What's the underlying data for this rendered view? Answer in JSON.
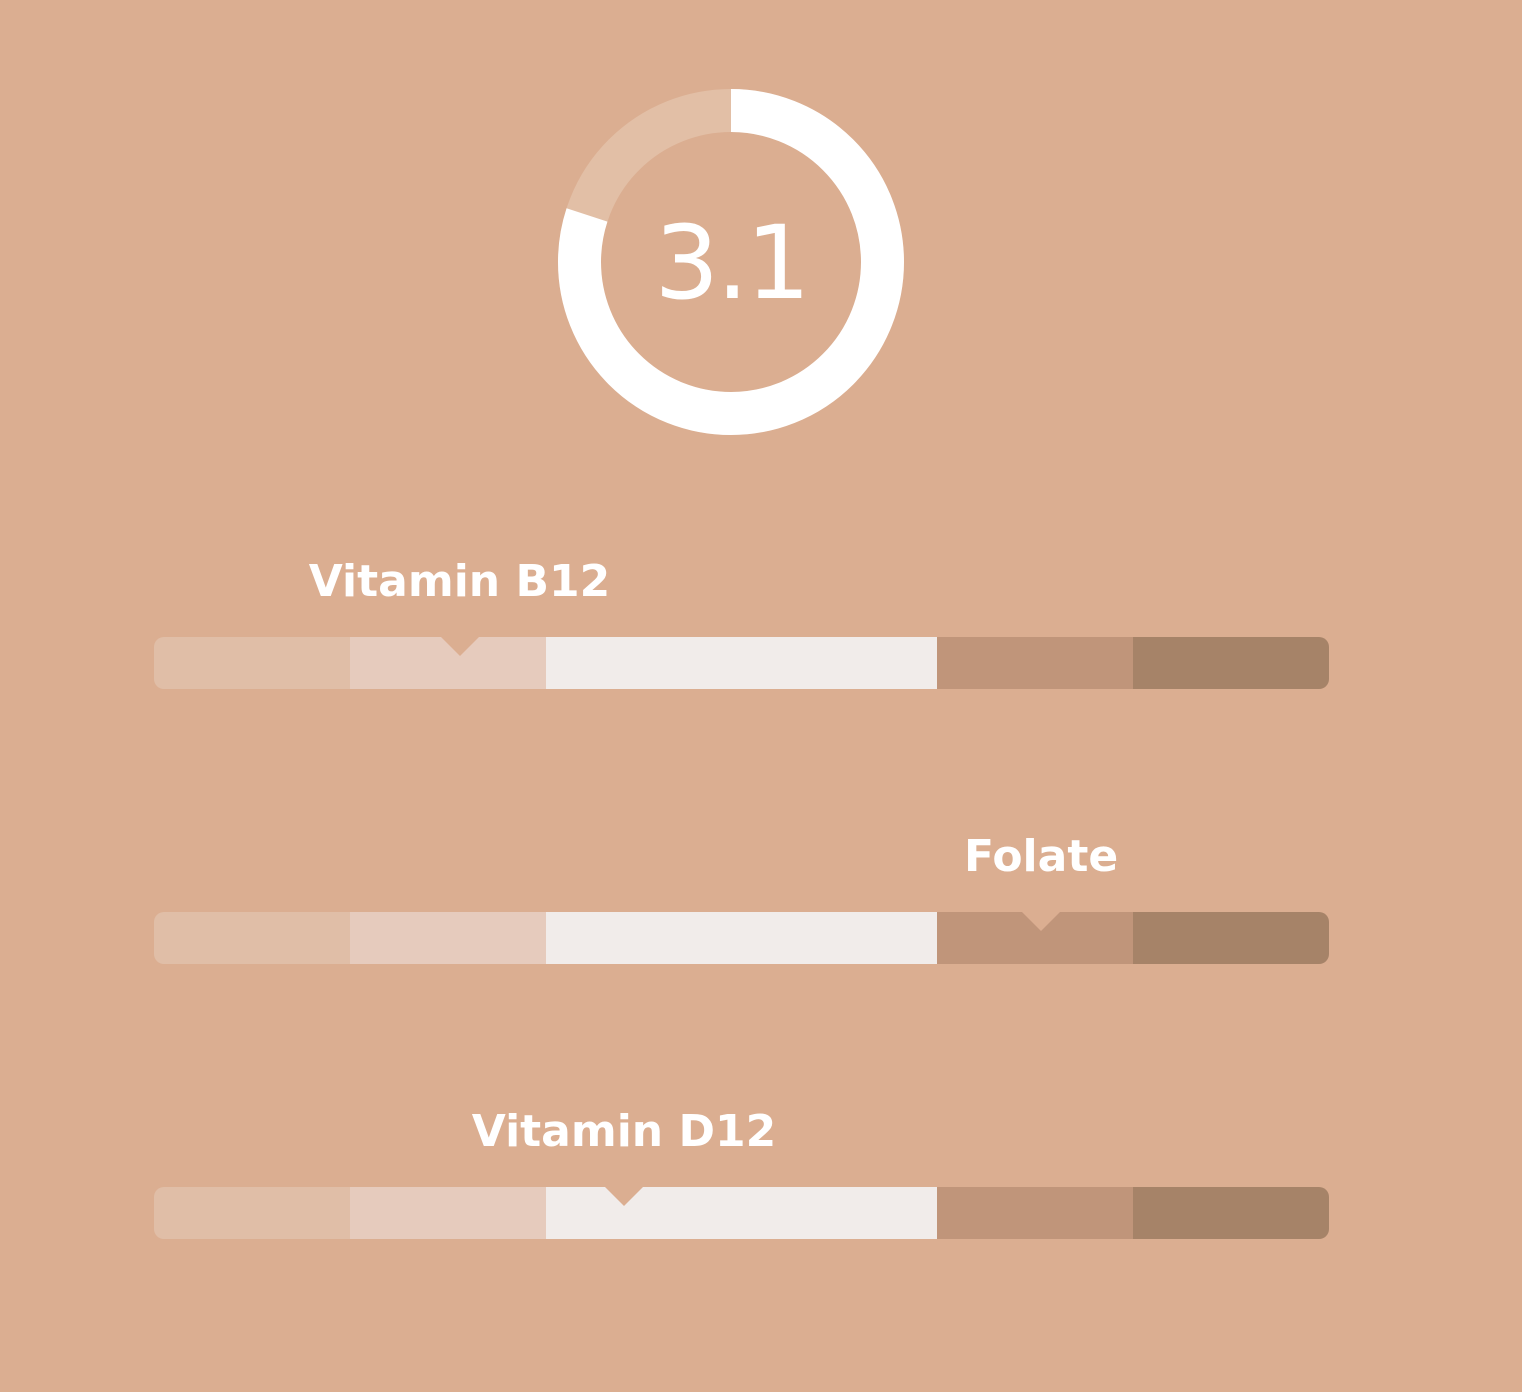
{
  "score": {
    "value": "3.1",
    "fraction": 0.8,
    "track_color": "#e2bfa6",
    "fill_color": "#ffffff"
  },
  "range_segments": [
    {
      "color": "#e0bea7",
      "weight": 1
    },
    {
      "color": "#e6cbbd",
      "weight": 1
    },
    {
      "color": "#f1ecea",
      "weight": 2
    },
    {
      "color": "#c0957a",
      "weight": 1
    },
    {
      "color": "#a68368",
      "weight": 1
    }
  ],
  "nutrients": [
    {
      "label": "Vitamin B12",
      "position": 0.26
    },
    {
      "label": "Folate",
      "position": 0.755
    },
    {
      "label": "Vitamin D12",
      "position": 0.4
    }
  ],
  "colors": {
    "background": "#dbae91",
    "text": "#ffffff"
  }
}
